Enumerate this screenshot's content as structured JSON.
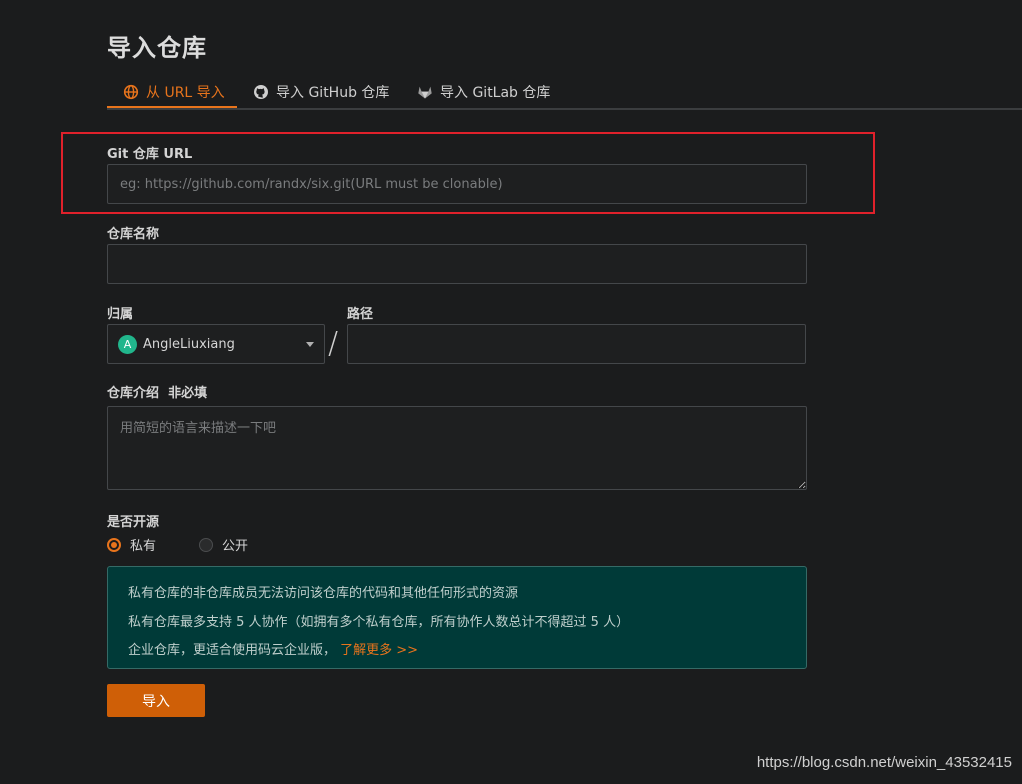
{
  "page": {
    "title": "导入仓库"
  },
  "tabs": [
    {
      "label": "从 URL 导入",
      "icon": "globe-icon",
      "active": true
    },
    {
      "label": "导入 GitHub 仓库",
      "icon": "github-icon",
      "active": false
    },
    {
      "label": "导入 GitLab 仓库",
      "icon": "gitlab-icon",
      "active": false
    }
  ],
  "form": {
    "git_url": {
      "label": "Git 仓库 URL",
      "value": "",
      "placeholder": "eg: https://github.com/randx/six.git(URL must be clonable)"
    },
    "repo_name": {
      "label": "仓库名称",
      "value": "",
      "placeholder": ""
    },
    "owner": {
      "label": "归属",
      "selected": "AngleLiuxiang",
      "avatar_letter": "A"
    },
    "separator": "/",
    "path": {
      "label": "路径",
      "value": "",
      "placeholder": ""
    },
    "description": {
      "label": "仓库介绍",
      "optional_note": "非必填",
      "value": "",
      "placeholder": "用简短的语言来描述一下吧"
    },
    "visibility": {
      "label": "是否开源",
      "options": [
        {
          "label": "私有",
          "checked": true
        },
        {
          "label": "公开",
          "checked": false
        }
      ]
    }
  },
  "notice": {
    "line1": "私有仓库的非仓库成员无法访问该仓库的代码和其他任何形式的资源",
    "line2": "私有仓库最多支持 5 人协作（如拥有多个私有仓库，所有协作人数总计不得超过 5 人）",
    "line3": "企业仓库，更适合使用码云企业版，",
    "link": "了解更多 >>"
  },
  "submit_label": "导入",
  "watermark": "https://blog.csdn.net/weixin_43532415",
  "colors": {
    "accent": "#e8741c",
    "background": "#1b1c1d",
    "notice_bg": "#003a38",
    "highlight": "#e0212b"
  }
}
